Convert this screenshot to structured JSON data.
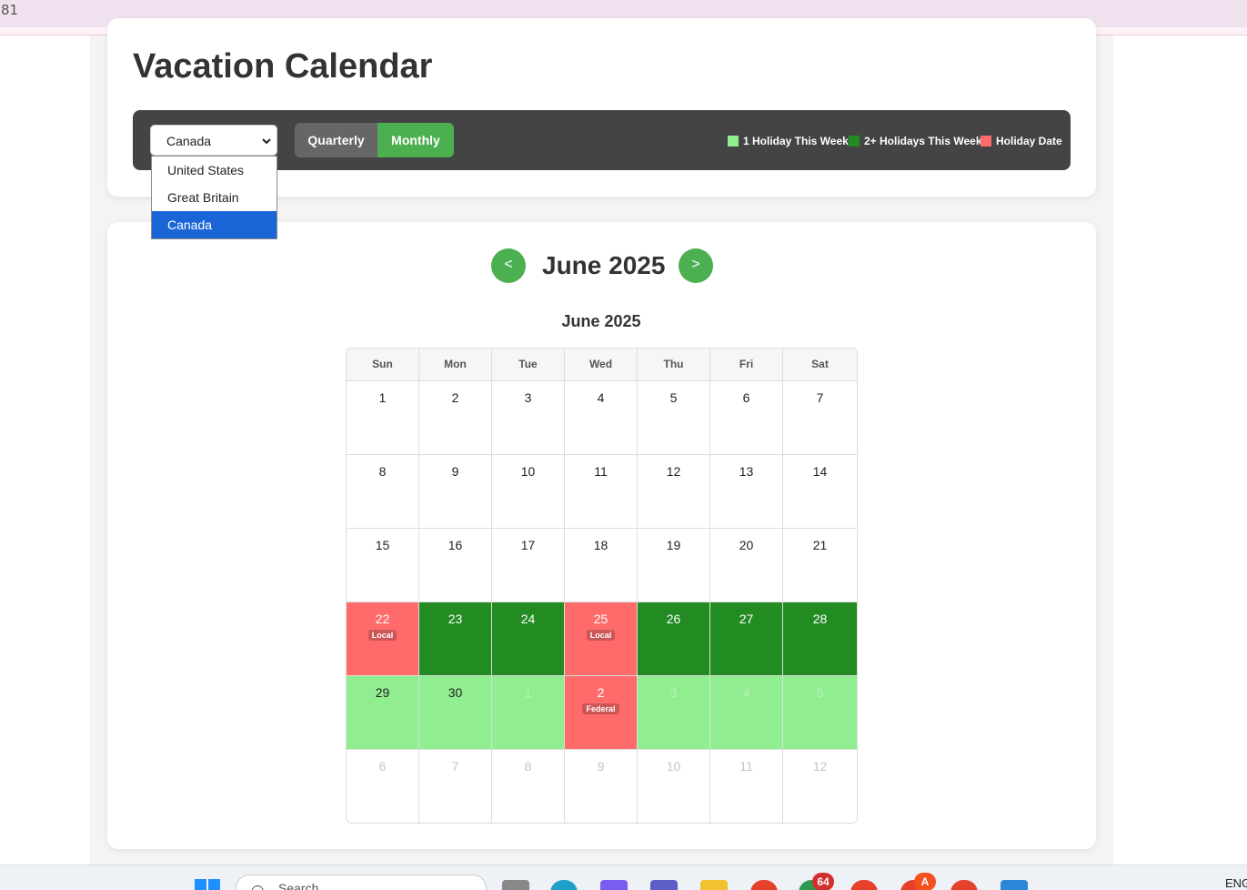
{
  "browser": {
    "corner_number": "81"
  },
  "page": {
    "title": "Vacation Calendar"
  },
  "country_select": {
    "value": "Canada",
    "options": [
      {
        "label": "United States",
        "selected": false
      },
      {
        "label": "Great Britain",
        "selected": false
      },
      {
        "label": "Canada",
        "selected": true
      }
    ]
  },
  "view_toggle": {
    "quarterly": "Quarterly",
    "monthly": "Monthly",
    "active": "Monthly"
  },
  "legend": [
    {
      "label": "1 Holiday This Week",
      "color": "#90ee90"
    },
    {
      "label": "2+ Holidays This Week",
      "color": "#228b22"
    },
    {
      "label": "Holiday Date",
      "color": "#ff6b6b"
    }
  ],
  "nav": {
    "prev_label": "<",
    "next_label": ">",
    "heading": "June 2025"
  },
  "calendar": {
    "title": "June 2025",
    "weekdays": [
      "Sun",
      "Mon",
      "Tue",
      "Wed",
      "Thu",
      "Fri",
      "Sat"
    ],
    "weeks": [
      [
        {
          "d": "1"
        },
        {
          "d": "2"
        },
        {
          "d": "3"
        },
        {
          "d": "4"
        },
        {
          "d": "5"
        },
        {
          "d": "6"
        },
        {
          "d": "7"
        }
      ],
      [
        {
          "d": "8"
        },
        {
          "d": "9"
        },
        {
          "d": "10"
        },
        {
          "d": "11"
        },
        {
          "d": "12"
        },
        {
          "d": "13"
        },
        {
          "d": "14"
        }
      ],
      [
        {
          "d": "15"
        },
        {
          "d": "16"
        },
        {
          "d": "17"
        },
        {
          "d": "18"
        },
        {
          "d": "19"
        },
        {
          "d": "20"
        },
        {
          "d": "21"
        }
      ],
      [
        {
          "d": "22",
          "type": "hol",
          "badge": "Local"
        },
        {
          "d": "23",
          "type": "dk"
        },
        {
          "d": "24",
          "type": "dk"
        },
        {
          "d": "25",
          "type": "hol",
          "badge": "Local"
        },
        {
          "d": "26",
          "type": "dk"
        },
        {
          "d": "27",
          "type": "dk"
        },
        {
          "d": "28",
          "type": "dk"
        }
      ],
      [
        {
          "d": "29",
          "type": "lt"
        },
        {
          "d": "30",
          "type": "lt"
        },
        {
          "d": "1",
          "type": "lt",
          "other": true
        },
        {
          "d": "2",
          "type": "hol",
          "badge": "Federal",
          "other": true
        },
        {
          "d": "3",
          "type": "lt",
          "other": true
        },
        {
          "d": "4",
          "type": "lt",
          "other": true
        },
        {
          "d": "5",
          "type": "lt",
          "other": true
        }
      ],
      [
        {
          "d": "6",
          "other": true
        },
        {
          "d": "7",
          "other": true
        },
        {
          "d": "8",
          "other": true
        },
        {
          "d": "9",
          "other": true
        },
        {
          "d": "10",
          "other": true
        },
        {
          "d": "11",
          "other": true
        },
        {
          "d": "12",
          "other": true
        }
      ]
    ]
  },
  "taskbar": {
    "search_placeholder": "Search",
    "badge_count": "64",
    "badge_letter": "A",
    "language": "ENG"
  }
}
